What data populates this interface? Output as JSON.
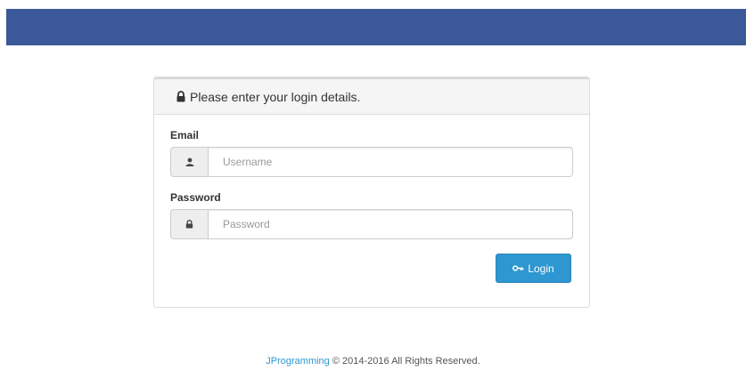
{
  "colors": {
    "top_bar": "#3b5998",
    "button": "#2e96d0",
    "link": "#2e96d0"
  },
  "panel": {
    "heading_icon": "lock-icon",
    "heading": "Please enter your login details."
  },
  "form": {
    "email_label": "Email",
    "email_icon": "user-icon",
    "email_placeholder": "Username",
    "email_value": "",
    "password_label": "Password",
    "password_icon": "lock-icon",
    "password_placeholder": "Password",
    "password_value": "",
    "login_icon": "key-icon",
    "login_label": "Login"
  },
  "footer": {
    "brand_link": "JProgramming",
    "copyright": " © 2014-2016 All Rights Reserved."
  }
}
